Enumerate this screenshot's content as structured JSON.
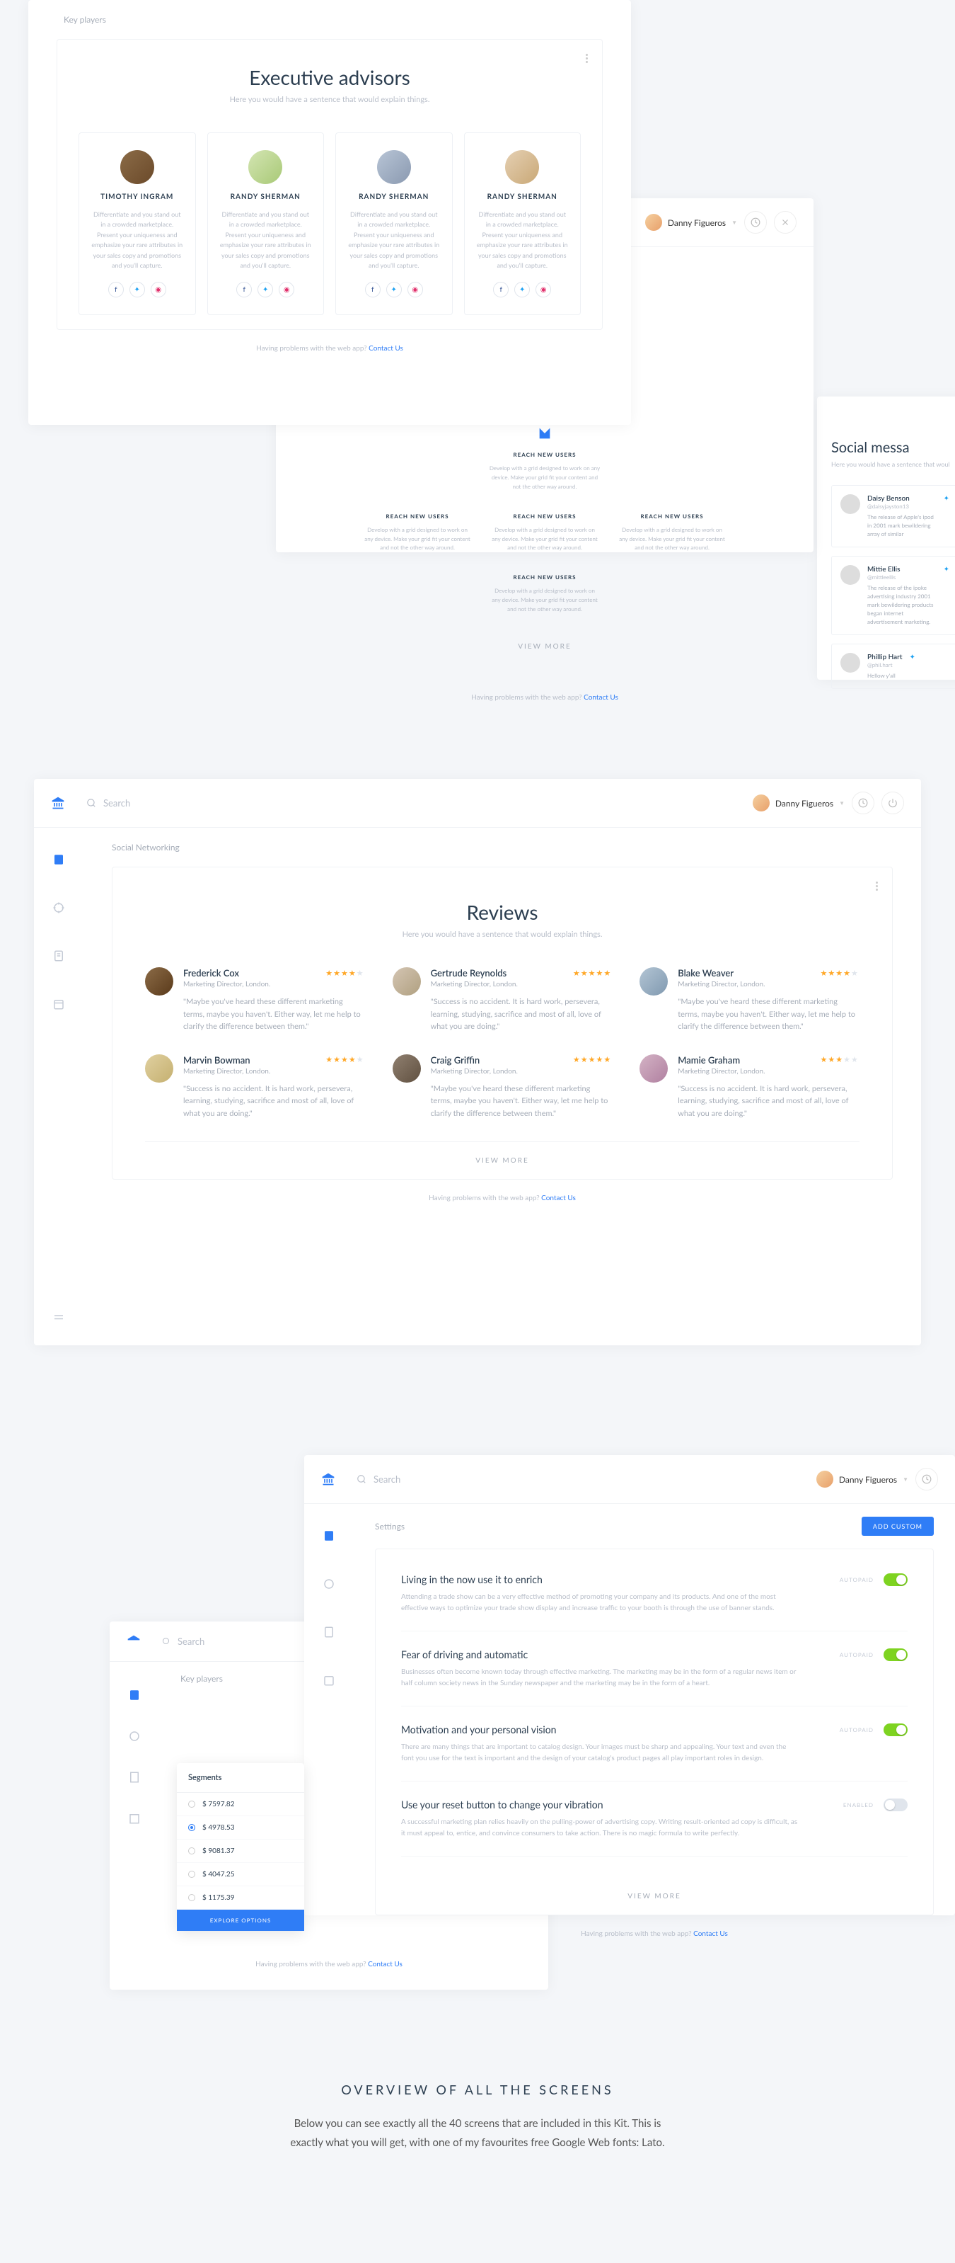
{
  "common": {
    "search": "Search",
    "user": "Danny Figueros",
    "help": "Having problems with the web app?",
    "contact": "Contact Us",
    "viewMore": "VIEW MORE"
  },
  "advisors": {
    "breadcrumb": "Key players",
    "title": "Executive advisors",
    "sub": "Here you would have a sentence that would explain things.",
    "desc": "Differentiate and you stand out in a crowded marketplace. Present your uniqueness and emphasize your rare attributes in your sales copy and promotions and you'll capture.",
    "people": [
      {
        "name": "TIMOTHY INGRAM"
      },
      {
        "name": "RANDY SHERMAN"
      },
      {
        "name": "RANDY SHERMAN"
      },
      {
        "name": "RANDY SHERMAN"
      }
    ]
  },
  "features": {
    "title": "REACH NEW USERS",
    "desc": "Develop with a grid designed to work on any device. Make your grid fit your content and not the other way around."
  },
  "social": {
    "title": "Social messa",
    "sub": "Here you would have a sentence that woul",
    "items": [
      {
        "name": "Daisy Benson",
        "user": "@daisyjayston13",
        "txt": "The release of Apple's ipod in 2001 mark bewildering array of similar"
      },
      {
        "name": "Mittie Ellis",
        "user": "@mittieellis",
        "txt": "The release of the ipoke advertising industry 2001 mark bewildering products began internet advertisement marketing."
      },
      {
        "name": "Phillip Hart",
        "user": "@phil.hart",
        "txt": "Hellow y'all"
      }
    ]
  },
  "reviews": {
    "breadcrumb": "Social Networking",
    "title": "Reviews",
    "sub": "Here you would have a sentence that would explain things.",
    "role": "Marketing Director, London.",
    "txt1": "\"Maybe you've heard these different marketing terms, maybe you haven't. Either way, let me help to clarify the difference between them.\"",
    "txt2": "\"Success is no accident. It is hard work, persevera, learning, studying, sacrifice and most of all, love of what you are doing.\"",
    "items": [
      {
        "name": "Frederick Cox",
        "stars": 4,
        "t": 1
      },
      {
        "name": "Gertrude Reynolds",
        "stars": 5,
        "t": 2
      },
      {
        "name": "Blake Weaver",
        "stars": 4,
        "t": 1
      },
      {
        "name": "Marvin Bowman",
        "stars": 4,
        "t": 2
      },
      {
        "name": "Craig Griffin",
        "stars": 5,
        "t": 1
      },
      {
        "name": "Mamie Graham",
        "stars": 3,
        "t": 2
      }
    ]
  },
  "settings": {
    "breadcrumb": "Settings",
    "addBtn": "ADD CUSTOM",
    "onLbl": "AUTOPAID",
    "offLbl": "ENABLED",
    "items": [
      {
        "title": "Living in the now use it to enrich",
        "desc": "Attending a trade show can be a very effective method of promoting your company and its products. And one of the most effective ways to optimize your trade show display and increase traffic to your booth is through the use of banner stands.",
        "on": true
      },
      {
        "title": "Fear of driving and automatic",
        "desc": "Businesses often become known today through effective marketing. The marketing may be in the form of a regular news item or half column society news in the Sunday newspaper and the marketing may be in the form of a heart.",
        "on": true
      },
      {
        "title": "Motivation and your personal vision",
        "desc": "There are many things that are important to catalog design. Your images must be sharp and appealing. Your text and even the font you use for the text is important and the design of your catalog's product pages all play important roles in design.",
        "on": true
      },
      {
        "title": "Use your reset button to change your vibration",
        "desc": "A successful marketing plan relies heavily on the pulling-power of advertising copy. Writing result-oriented ad copy is difficult, as it must appeal to, entice, and convince consumers to take action. There is no magic formula to write perfectly.",
        "on": false
      }
    ]
  },
  "segments": {
    "breadcrumb": "Key players",
    "title": "Segments",
    "btn": "EXPLORE OPTIONS",
    "items": [
      {
        "val": "$ 7597.82",
        "sel": false
      },
      {
        "val": "$ 4978.53",
        "sel": true
      },
      {
        "val": "$ 9081.37",
        "sel": false
      },
      {
        "val": "$ 4047.25",
        "sel": false
      },
      {
        "val": "$ 1175.39",
        "sel": false
      }
    ]
  },
  "overview": {
    "title": "OVERVIEW OF ALL THE SCREENS",
    "desc": "Below you can see exactly all the 40 screens that are included in this Kit. This is exactly what you will get, with one of my favourites free Google Web fonts: Lato."
  }
}
